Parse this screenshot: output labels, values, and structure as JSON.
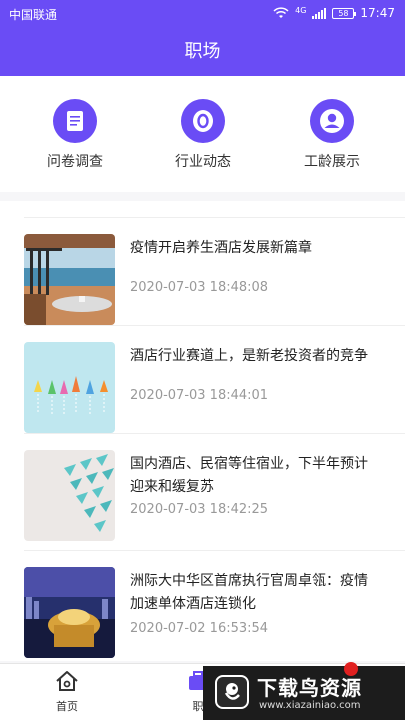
{
  "status_bar": {
    "carrier": "中国联通",
    "network": "4G",
    "battery": "58",
    "time": "17:47"
  },
  "header": {
    "title": "职场"
  },
  "shortcuts": [
    {
      "label": "问卷调查",
      "icon": "survey-document-icon"
    },
    {
      "label": "行业动态",
      "icon": "industry-news-icon"
    },
    {
      "label": "工龄展示",
      "icon": "user-profile-icon"
    }
  ],
  "news": [
    {
      "title": "疫情开启养生酒店发展新篇章",
      "time": "2020-07-03 18:48:08"
    },
    {
      "title": "酒店行业赛道上，是新老投资者的竞争",
      "time": "2020-07-03 18:44:01"
    },
    {
      "title": "国内酒店、民宿等住宿业，下半年预计迎来和缓复苏",
      "time": "2020-07-03 18:42:25"
    },
    {
      "title": "洲际大中华区首席执行官周卓瓴：疫情加速单体酒店连锁化",
      "time": "2020-07-02 16:53:54"
    }
  ],
  "tabbar": {
    "tabs": [
      {
        "label": "首页"
      },
      {
        "label": "职"
      }
    ]
  },
  "watermark": {
    "title": "下载鸟资源",
    "url": "www.xiazainiao.com"
  },
  "colors": {
    "primary": "#6a4cf5",
    "text": "#222222",
    "muted": "#999999"
  }
}
